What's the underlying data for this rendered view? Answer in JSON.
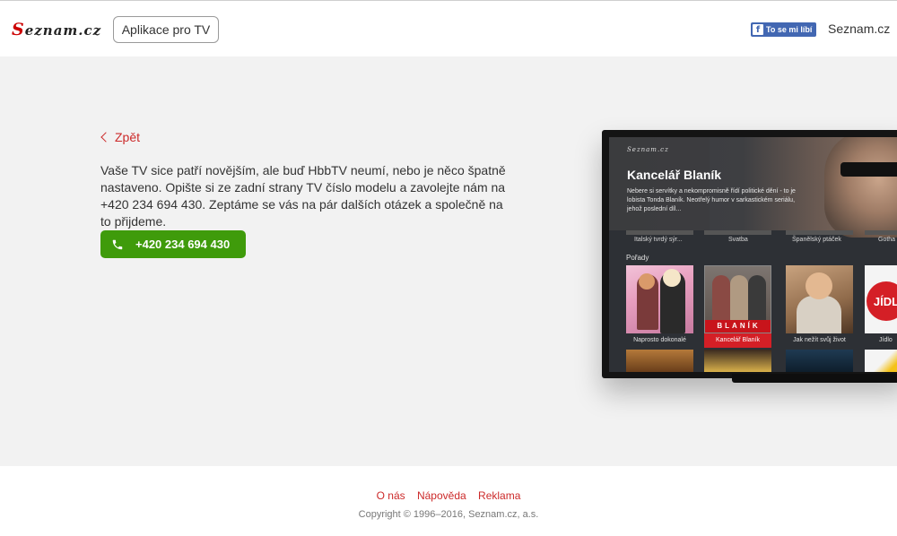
{
  "header": {
    "logo_text": "Seznam.cz",
    "app_button_label": "Aplikace pro TV",
    "fb_like_label": "To se mi líbí",
    "seznam_link": "Seznam.cz"
  },
  "main": {
    "back_label": "Zpět",
    "description": "Vaše TV sice patří novějším, ale buď HbbTV neumí, nebo je něco špatně nastaveno. Opište si ze zadní strany TV číslo modelu a zavolejte nám na +420 234 694 430. Zeptáme se vás na pár dalších otázek a společně na to přijdeme.",
    "phone_button_label": "+420 234 694 430"
  },
  "tv": {
    "logo_text": "Seznam.cz",
    "title": "Kancelář Blaník",
    "description": "Nebere si servítky a nekompromisně řídí politické dění - to je lobista Tonda Blaník. Neotřelý humor v sarkastickém seriálu, jehož poslední díl...",
    "row_labels": [
      "Italský tvrdý sýr...",
      "Svatba",
      "Španělský ptáček",
      "Gotha"
    ],
    "section_label": "Pořady",
    "cards": [
      {
        "caption": "Naprosto dokonalé"
      },
      {
        "caption": "Kancelář Blaník",
        "active": true,
        "banner": "BLANÍK"
      },
      {
        "caption": "Jak nežít svůj život"
      },
      {
        "caption": "Jídlo",
        "badge": "JÍDL"
      }
    ]
  },
  "footer": {
    "links": [
      "O nás",
      "Nápověda",
      "Reklama"
    ],
    "copyright": "Copyright © 1996–2016, Seznam.cz, a.s."
  },
  "colors": {
    "accent_red": "#cc2a2a",
    "call_green": "#3f9b0b",
    "background_gray": "#f2f2f2"
  }
}
